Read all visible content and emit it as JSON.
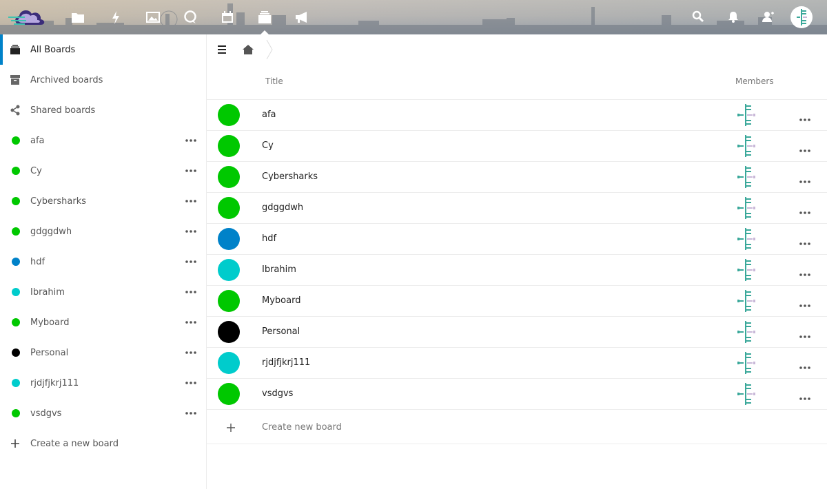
{
  "header": {
    "logo_icon": "nextcloud-logo-icon",
    "apps": [
      {
        "name": "files-icon"
      },
      {
        "name": "activity-icon"
      },
      {
        "name": "gallery-icon"
      },
      {
        "name": "talk-icon"
      },
      {
        "name": "calendar-icon"
      },
      {
        "name": "deck-icon"
      },
      {
        "name": "announcements-icon"
      }
    ],
    "right_icons": [
      "search-icon",
      "notifications-icon",
      "contacts-icon"
    ]
  },
  "sidebar": {
    "all_boards": "All Boards",
    "archived": "Archived boards",
    "shared": "Shared boards",
    "boards": [
      {
        "label": "afa",
        "color": "#00c800"
      },
      {
        "label": "Cy",
        "color": "#00c800"
      },
      {
        "label": "Cybersharks",
        "color": "#00c800"
      },
      {
        "label": "gdggdwh",
        "color": "#00c800"
      },
      {
        "label": "hdf",
        "color": "#0082c9"
      },
      {
        "label": "Ibrahim",
        "color": "#00cccc"
      },
      {
        "label": "Myboard",
        "color": "#00c800"
      },
      {
        "label": "Personal",
        "color": "#000000"
      },
      {
        "label": "rjdjfjkrj111",
        "color": "#00cccc"
      },
      {
        "label": "vsdgvs",
        "color": "#00c800"
      }
    ],
    "create": "Create a new board"
  },
  "main": {
    "col_title": "Title",
    "col_members": "Members",
    "rows": [
      {
        "title": "afa",
        "color": "#00c800"
      },
      {
        "title": "Cy",
        "color": "#00c800"
      },
      {
        "title": "Cybersharks",
        "color": "#00c800"
      },
      {
        "title": "gdggdwh",
        "color": "#00c800"
      },
      {
        "title": "hdf",
        "color": "#0082c9"
      },
      {
        "title": "Ibrahim",
        "color": "#00cccc"
      },
      {
        "title": "Myboard",
        "color": "#00c800"
      },
      {
        "title": "Personal",
        "color": "#000000"
      },
      {
        "title": "rjdjfjkrj111",
        "color": "#00cccc"
      },
      {
        "title": "vsdgvs",
        "color": "#00c800"
      }
    ],
    "create": "Create new board"
  },
  "colors": {
    "accent": "#0082c9",
    "green": "#00c800",
    "teal": "#00cccc",
    "black": "#000000"
  }
}
